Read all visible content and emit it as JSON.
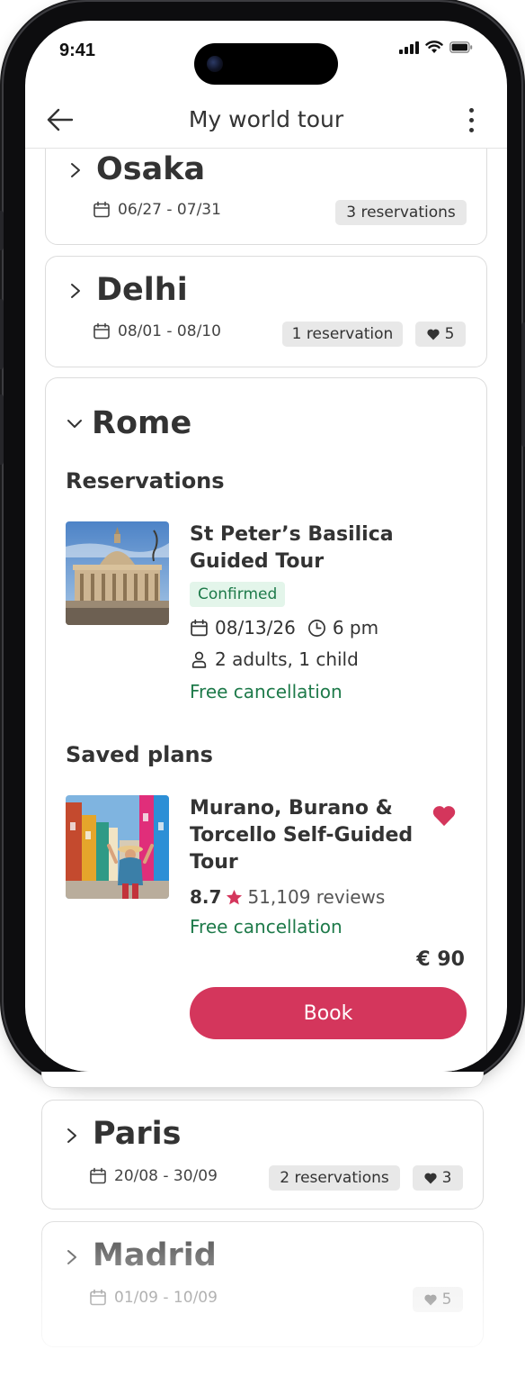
{
  "status_bar": {
    "time": "9:41"
  },
  "header": {
    "title": "My world tour"
  },
  "cities": [
    {
      "name": "Osaka",
      "dates": "06/27 - 07/31",
      "reservations": "3 reservations"
    },
    {
      "name": "Delhi",
      "dates": "08/01 - 08/10",
      "reservations": "1 reservation",
      "saved": "5"
    },
    {
      "name": "Rome"
    },
    {
      "name": "Paris",
      "dates": "20/08 - 30/09",
      "reservations": "2 reservations",
      "saved": "3"
    },
    {
      "name": "Madrid",
      "dates": "01/09 - 10/09",
      "saved": "5"
    }
  ],
  "rome": {
    "reservations_heading": "Reservations",
    "reservation": {
      "title_line1": "St Peter’s Basilica",
      "title_line2": "Guided Tour",
      "status": "Confirmed",
      "date": "08/13/26",
      "time": "6 pm",
      "guests": "2 adults, 1 child",
      "cancellation": "Free cancellation"
    },
    "saved_heading": "Saved plans",
    "saved_plan": {
      "title_line1": "Murano, Burano &",
      "title_line2": "Torcello Self-Guided",
      "title_line3": "Tour",
      "rating": "8.7",
      "reviews": "51,109 reviews",
      "cancellation": "Free cancellation",
      "price": "€ 90",
      "book_label": "Book"
    }
  },
  "colors": {
    "accent": "#d4365c",
    "success": "#1e7a4a",
    "confirmed_bg": "#e3f5ea",
    "badge_bg": "#e8e8e8"
  },
  "icons": {
    "back": "arrow-left-icon",
    "more": "more-vertical-icon",
    "expand": "chevron-right-icon",
    "collapse": "chevron-down-icon",
    "calendar": "calendar-icon",
    "clock": "clock-icon",
    "person": "person-icon",
    "heart": "heart-icon",
    "star": "star-icon"
  }
}
